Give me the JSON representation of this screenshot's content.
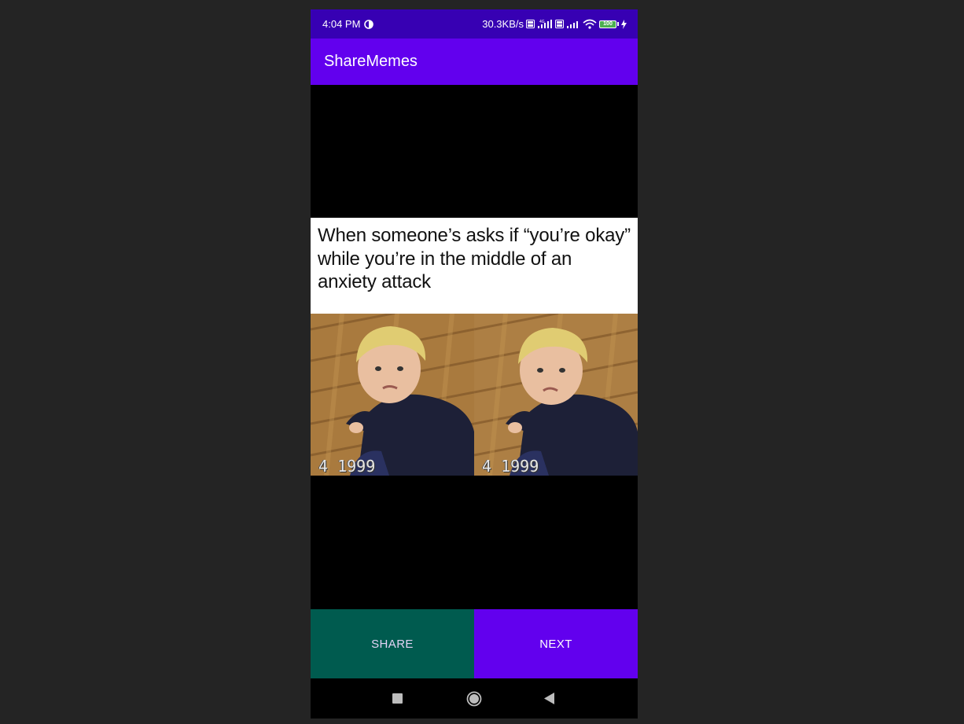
{
  "status_bar": {
    "time": "4:04 PM",
    "network_speed": "30.3KB/s",
    "network_type": "4G",
    "volte_label": "Vo LTE",
    "battery_level": "100",
    "icons": [
      "data-saver-icon",
      "volte-icon",
      "signal-icon",
      "volte-icon",
      "signal-icon",
      "wifi-icon",
      "battery-icon",
      "charging-icon"
    ]
  },
  "app_bar": {
    "title": "ShareMemes"
  },
  "meme": {
    "caption": "When someone’s asks if “you’re okay” while you’re in the middle of an anxiety attack",
    "date_stamps": [
      "4  1999",
      "4  1999"
    ]
  },
  "buttons": {
    "share_label": "SHARE",
    "next_label": "NEXT"
  },
  "nav_bar": {
    "icons": [
      "recent-apps-icon",
      "home-icon",
      "back-icon"
    ]
  },
  "colors": {
    "status_bar": "#3700b3",
    "app_bar": "#6200ee",
    "share_button": "#005b4f",
    "next_button": "#6200ee"
  }
}
